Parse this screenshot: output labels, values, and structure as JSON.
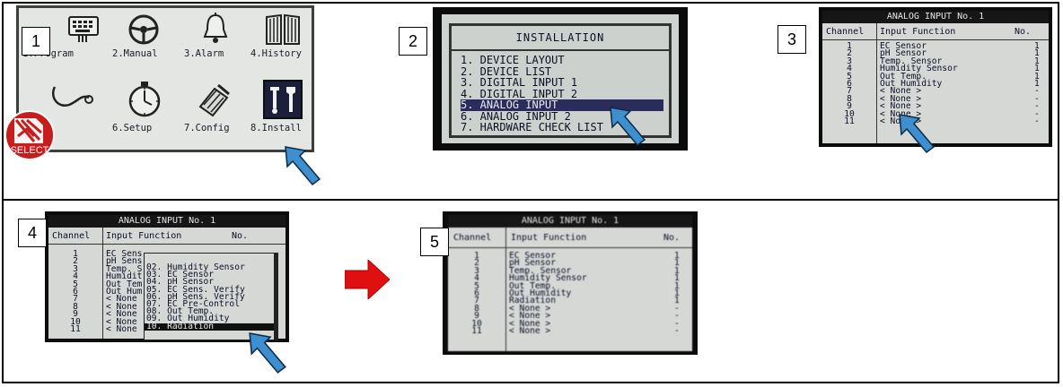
{
  "steps": [
    "1",
    "2",
    "3",
    "4",
    "5"
  ],
  "screen1": {
    "menu_items": [
      "1.Program",
      "2.Manual",
      "3.Alarm",
      "4.History",
      "6.Setup",
      "7.Config",
      "8.Install"
    ],
    "badge_text": "SELECT"
  },
  "screen2": {
    "title": "INSTALLATION",
    "items": [
      {
        "label": "1. DEVICE LAYOUT",
        "selected": false
      },
      {
        "label": "2. DEVICE LIST",
        "selected": false
      },
      {
        "label": "3. DIGITAL INPUT 1",
        "selected": false
      },
      {
        "label": "4. DIGITAL INPUT 2",
        "selected": false
      },
      {
        "label": "5. ANALOG INPUT",
        "selected": true
      },
      {
        "label": "6. ANALOG INPUT 2",
        "selected": false
      },
      {
        "label": "7. HARDWARE CHECK LIST",
        "selected": false
      }
    ]
  },
  "screen3": {
    "title": "ANALOG INPUT No.  1",
    "col_channel": "Channel",
    "col_function": "Input Function",
    "col_no": "No.",
    "rows": [
      {
        "ch": "1",
        "fn": "EC Sensor",
        "no": "1"
      },
      {
        "ch": "2",
        "fn": "pH Sensor",
        "no": "1"
      },
      {
        "ch": "3",
        "fn": "Temp. Sensor",
        "no": "1"
      },
      {
        "ch": "4",
        "fn": "Humidity Sensor",
        "no": "1"
      },
      {
        "ch": "5",
        "fn": "Out Temp.",
        "no": "1"
      },
      {
        "ch": "6",
        "fn": "Out Humidity",
        "no": "1"
      },
      {
        "ch": "7",
        "fn": "< None >",
        "no": "-"
      },
      {
        "ch": "8",
        "fn": "< None >",
        "no": "-"
      },
      {
        "ch": "9",
        "fn": "< None >",
        "no": "-"
      },
      {
        "ch": "10",
        "fn": "< None >",
        "no": "-"
      },
      {
        "ch": "11",
        "fn": "< None >",
        "no": "-"
      }
    ]
  },
  "screen4": {
    "title": "ANALOG INPUT No.  1",
    "col_channel": "Channel",
    "col_function": "Input Function",
    "col_no": "No.",
    "rows": [
      {
        "ch": "1",
        "fn": "EC Sens"
      },
      {
        "ch": "2",
        "fn": "pH Sens"
      },
      {
        "ch": "3",
        "fn": "Temp. S"
      },
      {
        "ch": "4",
        "fn": "Humidit"
      },
      {
        "ch": "5",
        "fn": "Out Tem"
      },
      {
        "ch": "6",
        "fn": "Out Hum"
      },
      {
        "ch": "7",
        "fn": "< None"
      },
      {
        "ch": "8",
        "fn": "< None"
      },
      {
        "ch": "9",
        "fn": "< None"
      },
      {
        "ch": "10",
        "fn": "< None"
      },
      {
        "ch": "11",
        "fn": "< None"
      }
    ],
    "popup": [
      {
        "label": "02. Humidity Sensor",
        "selected": false
      },
      {
        "label": "03. EC Sensor",
        "selected": false
      },
      {
        "label": "04. pH Sensor",
        "selected": false
      },
      {
        "label": "05. EC Sens. Verify",
        "selected": false
      },
      {
        "label": "06. pH Sens. Verify",
        "selected": false
      },
      {
        "label": "07. EC Pre-Control",
        "selected": false
      },
      {
        "label": "08. Out Temp.",
        "selected": false
      },
      {
        "label": "09. Out Humidity",
        "selected": false
      },
      {
        "label": "10. Radiation",
        "selected": true
      }
    ]
  },
  "screen5": {
    "title": "ANALOG INPUT No.  1",
    "col_channel": "Channel",
    "col_function": "Input Function",
    "col_no": "No.",
    "rows": [
      {
        "ch": "1",
        "fn": "EC Sensor",
        "no": "1"
      },
      {
        "ch": "2",
        "fn": "pH Sensor",
        "no": "1"
      },
      {
        "ch": "3",
        "fn": "Temp. Sensor",
        "no": "1"
      },
      {
        "ch": "4",
        "fn": "Humidity Sensor",
        "no": "1"
      },
      {
        "ch": "5",
        "fn": "Out Temp.",
        "no": "1"
      },
      {
        "ch": "6",
        "fn": "Out Humidity",
        "no": "1"
      },
      {
        "ch": "7",
        "fn": "Radiation",
        "no": "1"
      },
      {
        "ch": "8",
        "fn": "< None >",
        "no": "-"
      },
      {
        "ch": "9",
        "fn": "< None >",
        "no": "-"
      },
      {
        "ch": "10",
        "fn": "< None >",
        "no": "-"
      },
      {
        "ch": "11",
        "fn": "< None >",
        "no": "-"
      }
    ]
  },
  "colors": {
    "pointer": "#3d8fcf",
    "red_arrow": "#e01010",
    "selection": "#2a2d5c",
    "lcd_bg": "#d6d8d6"
  }
}
